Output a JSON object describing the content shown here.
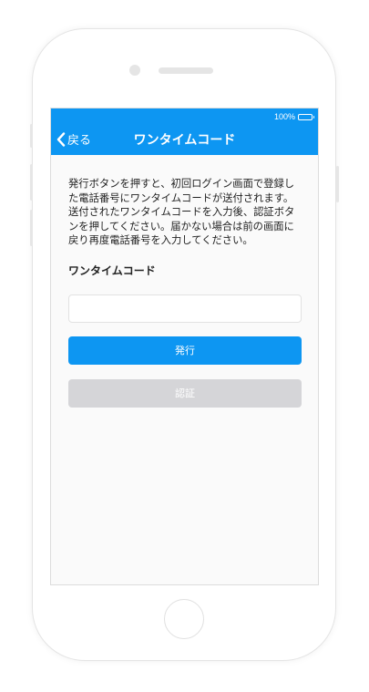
{
  "status_bar": {
    "battery_percent": "100%",
    "battery_level": 1.0
  },
  "nav": {
    "back_label": "戻る",
    "title": "ワンタイムコード"
  },
  "main": {
    "description": "発行ボタンを押すと、初回ログイン画面で登録した電話番号にワンタイムコードが送付されます。送付されたワンタイムコードを入力後、認証ボタンを押してください。届かない場合は前の画面に戻り再度電話番号を入力してください。",
    "field_label": "ワンタイムコード",
    "code_value": "",
    "code_placeholder": "",
    "issue_button": "発行",
    "verify_button": "認証"
  },
  "colors": {
    "accent": "#0d96f2",
    "disabled": "#d5d5d8"
  }
}
